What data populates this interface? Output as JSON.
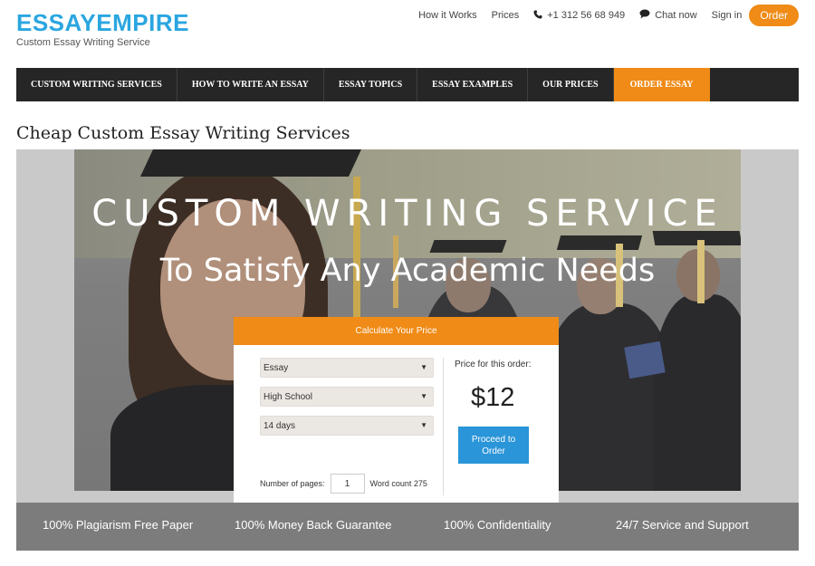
{
  "header": {
    "logo_title": "ESSAYEMPIRE",
    "logo_subtitle": "Custom Essay Writing Service",
    "links": {
      "how_it_works": "How it Works",
      "prices": "Prices",
      "phone": "+1 312 56 68 949",
      "chat": "Chat now",
      "sign_in": "Sign in",
      "order": "Order"
    },
    "icons": {
      "phone": "phone-icon",
      "chat": "chat-bubble-icon"
    }
  },
  "mainnav": {
    "items": [
      "CUSTOM WRITING SERVICES",
      "HOW TO WRITE AN ESSAY",
      "ESSAY TOPICS",
      "ESSAY EXAMPLES",
      "OUR PRICES",
      "ORDER ESSAY"
    ],
    "active_index": 5
  },
  "page_title": "Cheap Custom Essay Writing Services",
  "hero": {
    "headline": "CUSTOM WRITING SERVICE",
    "subheadline": "To Satisfy Any Academic Needs"
  },
  "calculator": {
    "title": "Calculate Your Price",
    "paper_type": "Essay",
    "academic_level": "High School",
    "deadline": "14 days",
    "pages_label": "Number of pages:",
    "pages_value": "1",
    "word_count": "Word count 275",
    "price_label": "Price for this order:",
    "price_value": "$12",
    "proceed_label": "Proceed to Order"
  },
  "features": [
    "100% Plagiarism Free Paper",
    "100% Money Back Guarantee",
    "100% Confidentiality",
    "24/7 Service and Support"
  ],
  "colors": {
    "brand_blue": "#2aa6e0",
    "accent_orange": "#ef8b16",
    "nav_dark": "#262626",
    "button_blue": "#2a95d8",
    "features_gray": "#7c7c7c"
  }
}
